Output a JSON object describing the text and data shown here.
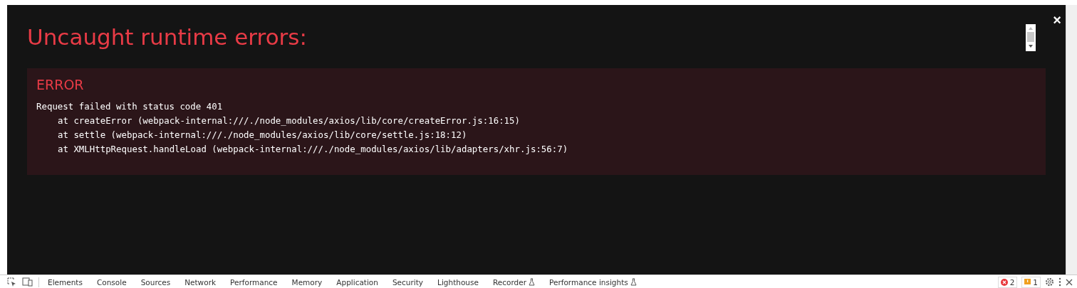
{
  "overlay": {
    "title": "Uncaught runtime errors:",
    "close": "×",
    "error": {
      "heading": "ERROR",
      "message": "Request failed with status code 401",
      "stack": [
        "at createError (webpack-internal:///./node_modules/axios/lib/core/createError.js:16:15)",
        "at settle (webpack-internal:///./node_modules/axios/lib/core/settle.js:18:12)",
        "at XMLHttpRequest.handleLoad (webpack-internal:///./node_modules/axios/lib/adapters/xhr.js:56:7)"
      ]
    }
  },
  "devtools": {
    "tabs": [
      {
        "label": "Elements",
        "experimental": false
      },
      {
        "label": "Console",
        "experimental": false
      },
      {
        "label": "Sources",
        "experimental": false
      },
      {
        "label": "Network",
        "experimental": false
      },
      {
        "label": "Performance",
        "experimental": false
      },
      {
        "label": "Memory",
        "experimental": false
      },
      {
        "label": "Application",
        "experimental": false
      },
      {
        "label": "Security",
        "experimental": false
      },
      {
        "label": "Lighthouse",
        "experimental": false
      },
      {
        "label": "Recorder",
        "experimental": true
      },
      {
        "label": "Performance insights",
        "experimental": true
      }
    ],
    "errors": "2",
    "warnings": "1"
  }
}
